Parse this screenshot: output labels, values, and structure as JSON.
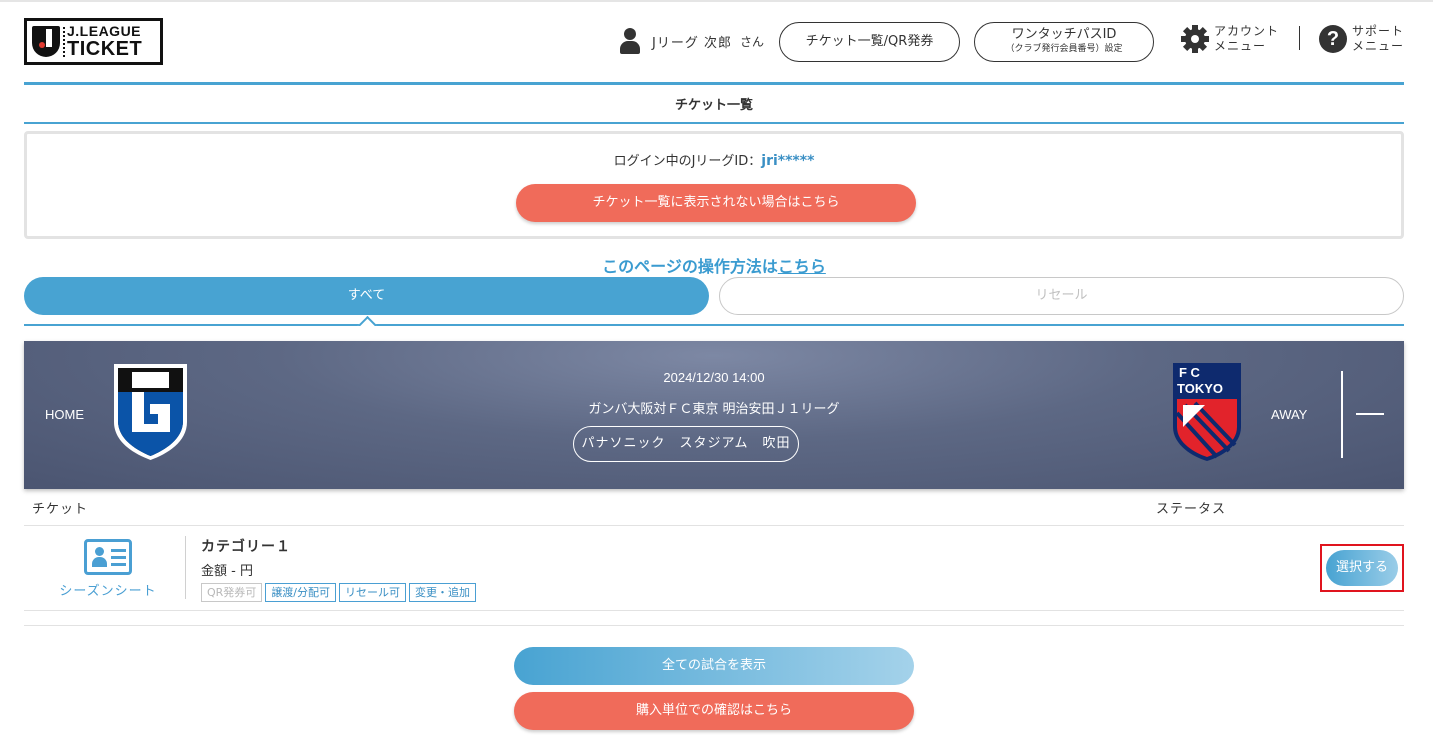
{
  "brand": {
    "logo_line1": "J.LEAGUE",
    "logo_line2": "TICKET",
    "accent": "#48a3d2",
    "coral": "#f06b5a"
  },
  "header": {
    "user_name": "Jリーグ 次郎",
    "user_suffix": "さん",
    "ticket_list_qr_label": "チケット一覧/QR発券",
    "onetouch_line1": "ワンタッチパスID",
    "onetouch_line2": "（クラブ発行会員番号）設定",
    "account_line1": "アカウント",
    "account_line2": "メニュー",
    "support_line1": "サポート",
    "support_line2": "メニュー",
    "help_glyph": "?"
  },
  "page": {
    "title": "チケット一覧",
    "login_prefix": "ログイン中のJリーグID：",
    "login_id": "jri*****",
    "not_shown_button": "チケット一覧に表示されない場合はこちら",
    "howto_prefix": "このページの操作方法は",
    "howto_link": "こちら"
  },
  "tabs": [
    {
      "label": "すべて",
      "active": true
    },
    {
      "label": "リセール",
      "active": false
    }
  ],
  "match": {
    "home_label": "HOME",
    "away_label": "AWAY",
    "datetime": "2024/12/30 14:00",
    "name": "ガンバ大阪対ＦＣ東京 明治安田Ｊ１リーグ",
    "venue": "パナソニック　スタジアム　吹田",
    "home_crest": "gamba-osaka-crest",
    "away_crest": "fc-tokyo-crest",
    "away_crest_text_top": "F   C",
    "away_crest_text_mid": "TOKYO"
  },
  "ticket_list": {
    "col_ticket": "チケット",
    "col_status": "ステータス",
    "rows": [
      {
        "ticket_type": "シーズンシート",
        "category": "カテゴリー１",
        "price": "金額 - 円",
        "tags": [
          {
            "label": "QR発券可",
            "enabled": false
          },
          {
            "label": "譲渡/分配可",
            "enabled": true
          },
          {
            "label": "リセール可",
            "enabled": true
          },
          {
            "label": "変更・追加",
            "enabled": true
          }
        ],
        "action": "選択する"
      }
    ]
  },
  "footer": {
    "show_all_matches": "全ての試合を表示",
    "purchase_unit": "購入単位での確認はこちら"
  }
}
